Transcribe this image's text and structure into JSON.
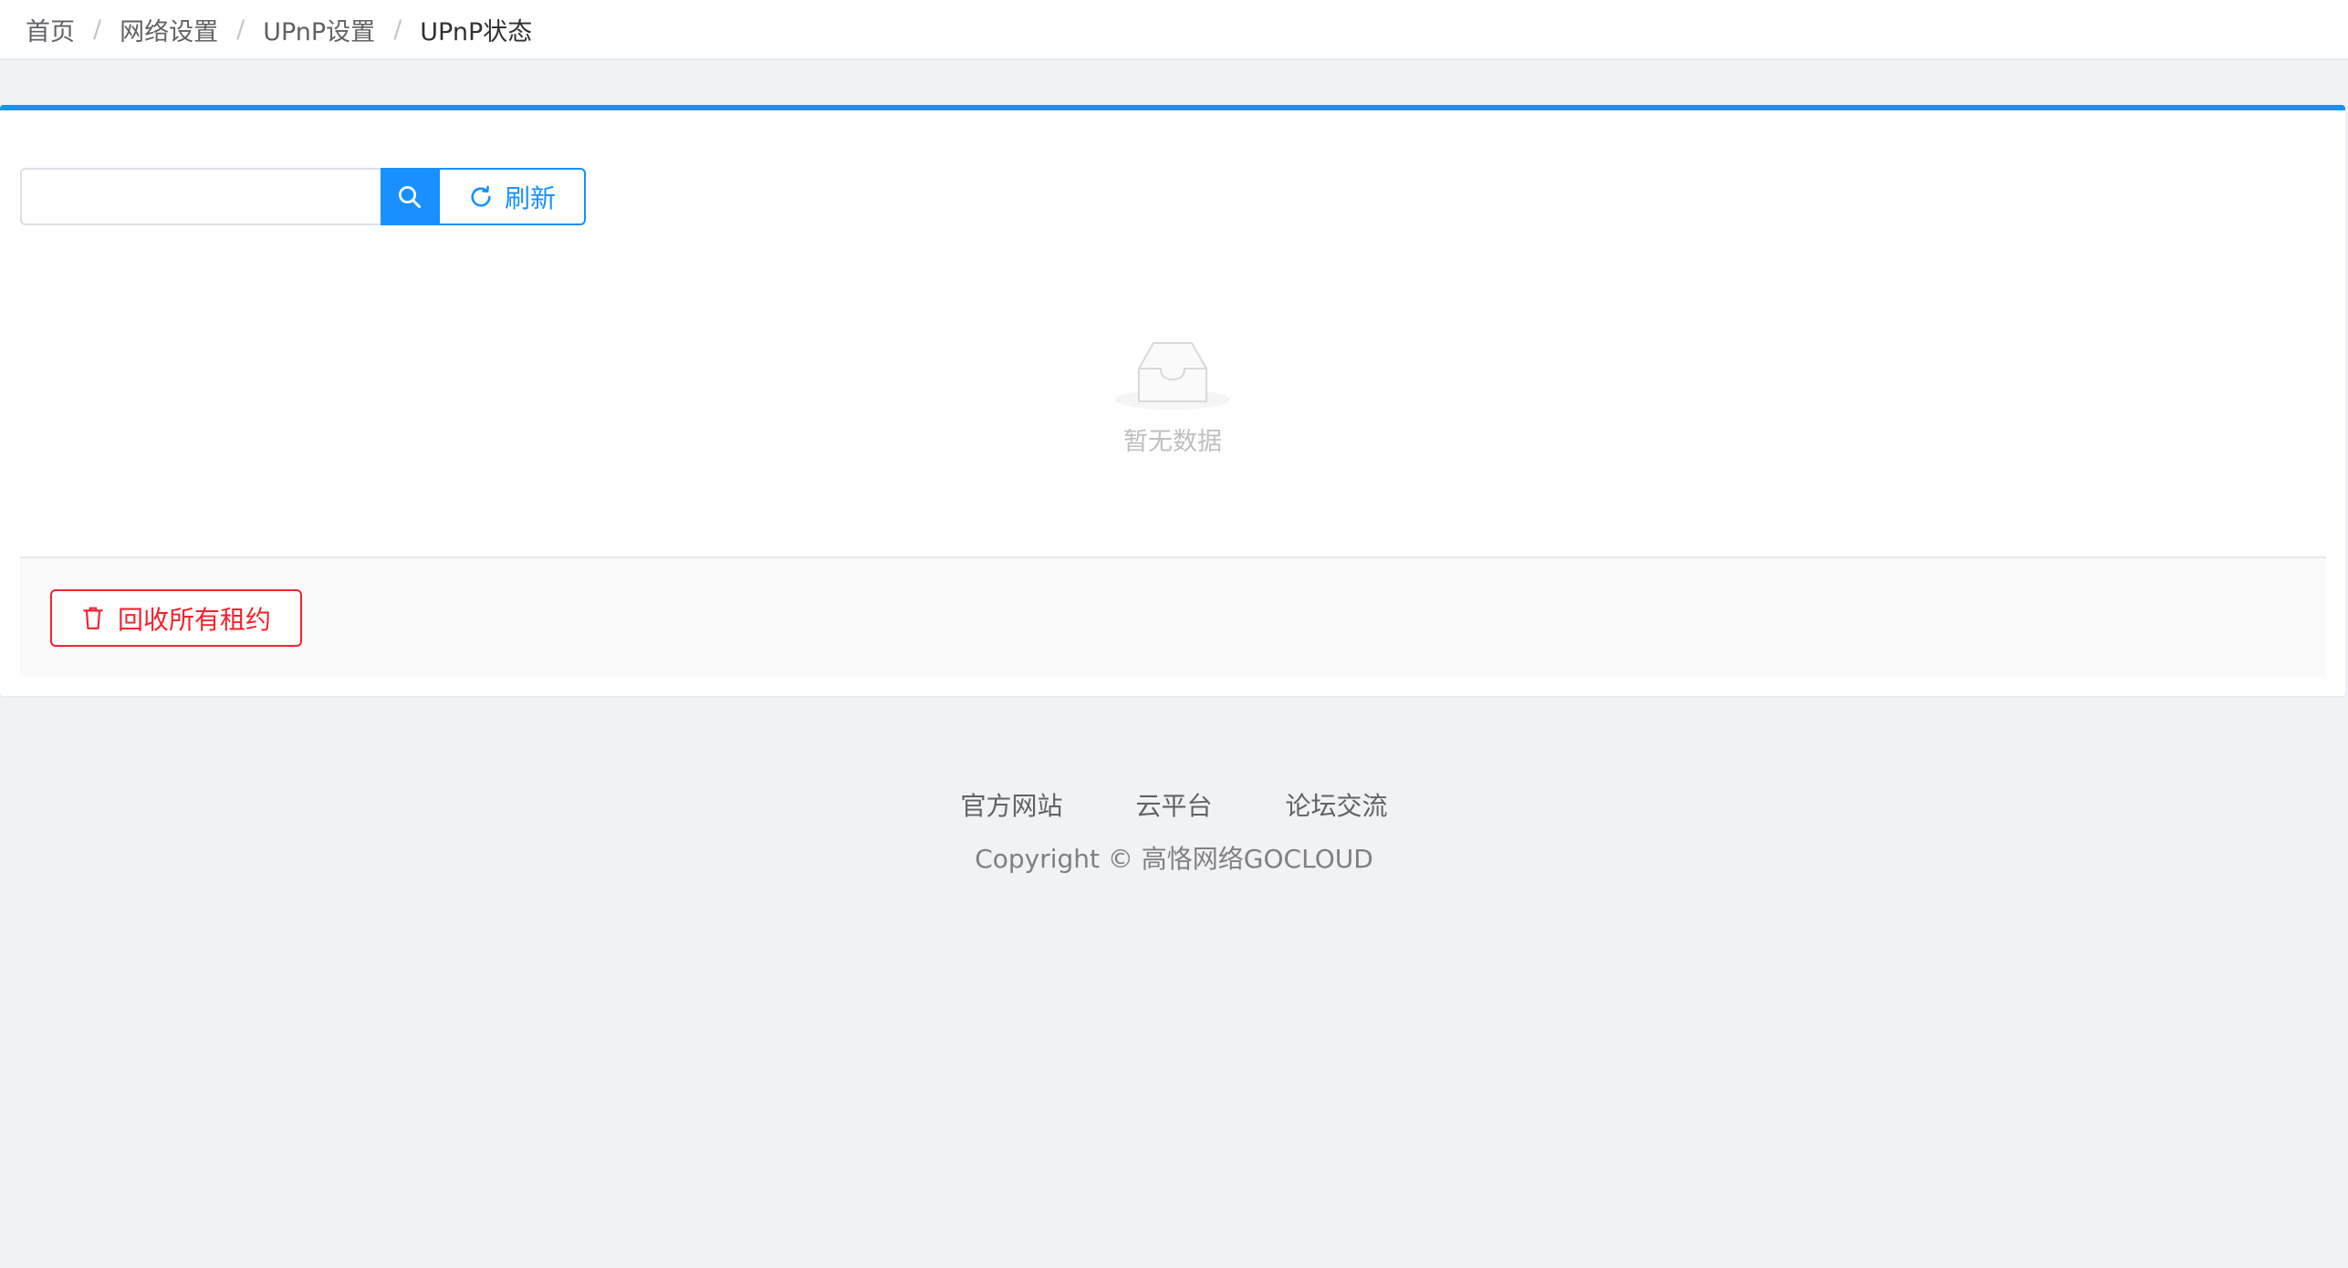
{
  "breadcrumb": {
    "items": [
      "首页",
      "网络设置",
      "UPnP设置",
      "UPnP状态"
    ],
    "separator": "/"
  },
  "toolbar": {
    "search_value": "",
    "search_icon": "search-icon",
    "refresh_icon": "refresh-icon",
    "refresh_label": "刷新"
  },
  "empty_state": {
    "icon": "empty-inbox-icon",
    "text": "暂无数据"
  },
  "actions": {
    "reclaim_icon": "trash-icon",
    "reclaim_label": "回收所有租约"
  },
  "footer": {
    "links": [
      "官方网站",
      "云平台",
      "论坛交流"
    ],
    "copyright": "Copyright © 高恪网络GOCLOUD"
  },
  "colors": {
    "primary": "#1890ff",
    "danger": "#f5222d",
    "page_bg": "#f0f2f5"
  }
}
